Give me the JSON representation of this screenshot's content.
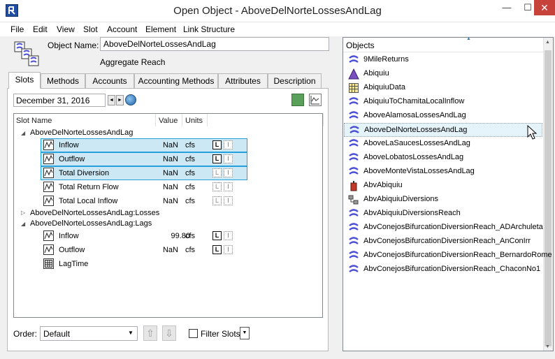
{
  "window": {
    "title": "Open Object - AboveDelNorteLossesAndLag",
    "minimize_glyph": "—",
    "maximize_glyph": "☐",
    "close_glyph": "✕"
  },
  "menu": [
    "File",
    "Edit",
    "View",
    "Slot",
    "Account",
    "Element",
    "Link Structure"
  ],
  "object": {
    "name_label": "Object Name:",
    "name_value": "AboveDelNorteLossesAndLag",
    "type": "Aggregate Reach"
  },
  "tabs": [
    {
      "label": "Slots",
      "active": true
    },
    {
      "label": "Methods",
      "active": false
    },
    {
      "label": "Accounts",
      "active": false
    },
    {
      "label": "Accounting Methods",
      "active": false
    },
    {
      "label": "Attributes",
      "active": false
    },
    {
      "label": "Description",
      "active": false
    }
  ],
  "date": "December 31, 2016",
  "date_prev_glyph": "◄",
  "date_next_glyph": "►",
  "columns": {
    "slot_name": "Slot Name",
    "value": "Value",
    "units": "Units"
  },
  "tree": {
    "groups": [
      {
        "label": "AboveDelNorteLossesAndLag",
        "expanded": true,
        "slots": [
          {
            "name": "Inflow",
            "value": "NaN",
            "units": "cfs",
            "selected": true,
            "l_bold": true
          },
          {
            "name": "Outflow",
            "value": "NaN",
            "units": "cfs",
            "selected": true,
            "l_bold": true
          },
          {
            "name": "Total Diversion",
            "value": "NaN",
            "units": "cfs",
            "selected": true,
            "l_bold": false
          },
          {
            "name": "Total Return Flow",
            "value": "NaN",
            "units": "cfs",
            "selected": false,
            "l_bold": false
          },
          {
            "name": "Total Local Inflow",
            "value": "NaN",
            "units": "cfs",
            "selected": false,
            "l_bold": false
          }
        ]
      },
      {
        "label": "AboveDelNorteLossesAndLag:Losses",
        "expanded": false,
        "slots": []
      },
      {
        "label": "AboveDelNorteLossesAndLag:Lags",
        "expanded": true,
        "slots": [
          {
            "name": "Inflow",
            "value": "99.80",
            "units": "cfs",
            "selected": false,
            "l_bold": true
          },
          {
            "name": "Outflow",
            "value": "NaN",
            "units": "cfs",
            "selected": false,
            "l_bold": true
          },
          {
            "name": "LagTime",
            "value": "",
            "units": "",
            "selected": false,
            "table": true
          }
        ]
      }
    ],
    "expanded_glyph": "◢",
    "collapsed_glyph": "▷",
    "l_glyph": "L",
    "i_glyph": "I"
  },
  "order": {
    "label": "Order:",
    "value": "Default",
    "dropdown_glyph": "▼",
    "up_glyph": "⇧",
    "down_glyph": "⇩"
  },
  "filter": {
    "label": "Filter Slots",
    "checked": false,
    "dropdown_glyph": "▼"
  },
  "objects_panel": {
    "header": "Objects",
    "sort_glyph": "▲",
    "scroll_up_glyph": "▲",
    "scroll_down_glyph": "▼",
    "items": [
      {
        "label": "9MileReturns",
        "icon": "reach"
      },
      {
        "label": "Abiquiu",
        "icon": "reservoir"
      },
      {
        "label": "AbiquiuData",
        "icon": "data"
      },
      {
        "label": "AbiquiuToChamitaLocalInflow",
        "icon": "reach"
      },
      {
        "label": "AboveAlamosaLossesAndLag",
        "icon": "reach"
      },
      {
        "label": "AboveDelNorteLossesAndLag",
        "icon": "reach"
      },
      {
        "label": "AboveLaSaucesLossesAndLag",
        "icon": "reach"
      },
      {
        "label": "AboveLobatosLossesAndLag",
        "icon": "reach"
      },
      {
        "label": "AboveMonteVistaLossesAndLag",
        "icon": "reach"
      },
      {
        "label": "AbvAbiquiu",
        "icon": "control-point"
      },
      {
        "label": "AbvAbiquiuDiversions",
        "icon": "diversion"
      },
      {
        "label": "AbvAbiquiuDiversionsReach",
        "icon": "reach"
      },
      {
        "label": "AbvConejosBifurcationDiversionReach_ADArchuleta",
        "icon": "reach"
      },
      {
        "label": "AbvConejosBifurcationDiversionReach_AnConIrr",
        "icon": "reach"
      },
      {
        "label": "AbvConejosBifurcationDiversionReach_BernardoRome",
        "icon": "reach"
      },
      {
        "label": "AbvConejosBifurcationDiversionReach_ChaconNo1",
        "icon": "reach"
      }
    ]
  },
  "colors": {
    "selection": "#cce8f4",
    "selection_border": "#26a0da",
    "reach_icon": "#4b4fd6",
    "close_button": "#c7423a"
  }
}
